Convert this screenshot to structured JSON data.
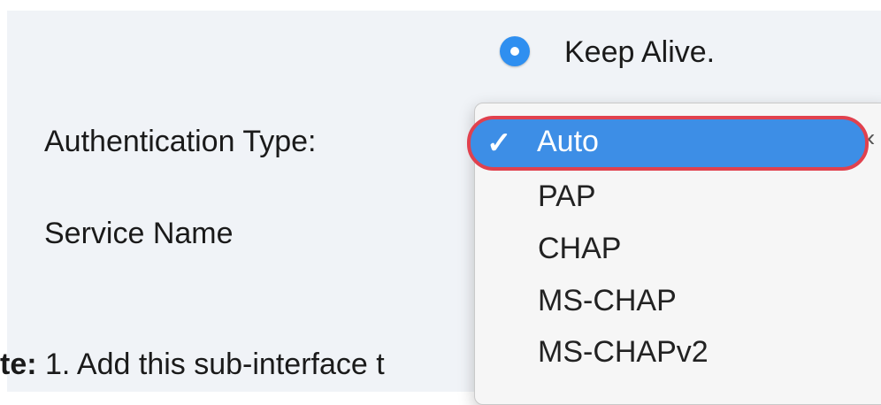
{
  "keep_alive": {
    "label": "Keep Alive.",
    "selected": true
  },
  "fields": {
    "authentication_type_label": "Authentication Type:",
    "service_name_label": "Service Name"
  },
  "auth_dropdown": {
    "selected": "Auto",
    "check_mark": "✓",
    "options": [
      "Auto",
      "PAP",
      "CHAP",
      "MS-CHAP",
      "MS-CHAPv2"
    ]
  },
  "note": {
    "prefix": "te:",
    "text": " 1. Add this sub-interface t"
  },
  "colors": {
    "selection": "#3d8ee6",
    "highlight_outline": "#e0414e",
    "radio": "#2f8ff0"
  }
}
